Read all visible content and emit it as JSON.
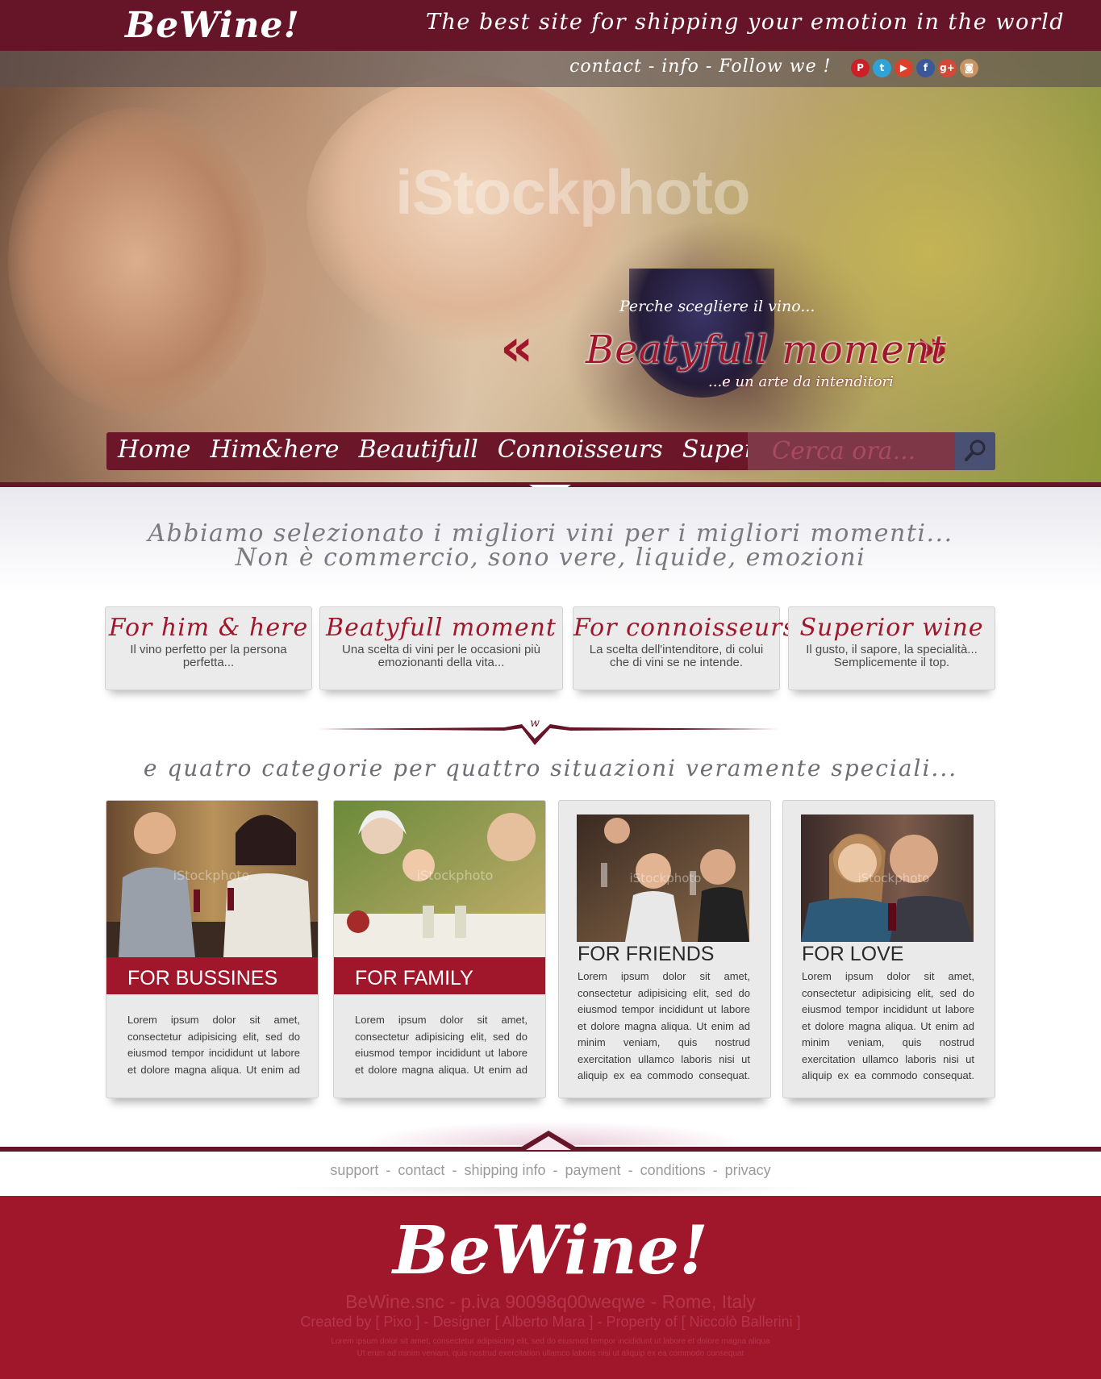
{
  "header": {
    "logo": "BeWine!",
    "tagline": "The best site for shipping your emotion in the world"
  },
  "subbar": {
    "follow_line": "contact - info - Follow we !",
    "socials": [
      {
        "icon": "pinterest-icon",
        "glyph": "P",
        "color": "#cb2027"
      },
      {
        "icon": "twitter-icon",
        "glyph": "t",
        "color": "#2fa3d5"
      },
      {
        "icon": "youtube-icon",
        "glyph": "▶",
        "color": "#d9412b"
      },
      {
        "icon": "facebook-icon",
        "glyph": "f",
        "color": "#3b5998"
      },
      {
        "icon": "google-plus-icon",
        "glyph": "g+",
        "color": "#d34836"
      },
      {
        "icon": "instagram-icon",
        "glyph": "◙",
        "color": "#c99463"
      }
    ]
  },
  "hero": {
    "watermark": "iStockphoto",
    "kicker": "Perche scegliere il vino...",
    "title": "Beatyfull moment",
    "subtitle": "...e un arte da intenditori",
    "prev_arrow": "«",
    "next_arrow": "»"
  },
  "nav": {
    "items": [
      "Home",
      "Him&here",
      "Beautifull",
      "Connoisseurs",
      "Superior"
    ],
    "search_placeholder": "Cerca ora..."
  },
  "intro": {
    "line1": "Abbiamo selezionato i migliori vini per i migliori momenti...",
    "line2": "Non è commercio, sono vere, liquide, emozioni"
  },
  "features": [
    {
      "title": "For him & here",
      "desc": "Il vino perfetto per la persona perfetta..."
    },
    {
      "title": "Beatyfull moment",
      "desc": "Una scelta di vini per le occasioni più emozionanti della vita..."
    },
    {
      "title": "For connoisseurs",
      "desc": "La scelta dell'intenditore, di colui che di vini se ne intende."
    },
    {
      "title": "Superior wine",
      "desc": "Il gusto, il sapore, la specialità... Semplicemente il top."
    }
  ],
  "divider_mark": "w",
  "categories_heading": "e quatro categorie per quattro situazioni veramente speciali...",
  "categories": [
    {
      "title": "FOR BUSSINES",
      "body": "Lorem ipsum dolor sit amet, consectetur adipisicing elit, sed do eiusmod tempor incididunt ut labore et dolore magna aliqua. Ut enim ad minim",
      "watermark": "iStockphoto"
    },
    {
      "title": "FOR FAMILY",
      "body": "Lorem ipsum dolor sit amet, consectetur adipisicing elit, sed do eiusmod tempor incididunt ut labore et dolore magna aliqua. Ut enim ad minim",
      "watermark": "iStockphoto"
    },
    {
      "title": "FOR FRIENDS",
      "body": "Lorem ipsum dolor sit amet, consectetur adipisicing elit, sed do eiusmod tempor incididunt ut labore et dolore magna aliqua. Ut enim ad minim veniam, quis nostrud exercitation ullamco laboris nisi ut aliquip ex ea commodo consequat. Duis aute irure",
      "watermark": "iStockphoto"
    },
    {
      "title": "FOR LOVE",
      "body": "Lorem ipsum dolor sit amet, consectetur adipisicing elit, sed do eiusmod tempor incididunt ut labore et dolore magna aliqua. Ut enim ad minim veniam, quis nostrud exercitation ullamco laboris nisi ut aliquip ex ea commodo consequat. Duis aute irure",
      "watermark": "iStockphoto"
    }
  ],
  "footer_links": [
    "support",
    "contact",
    "shipping info",
    "payment",
    "conditions",
    "privacy"
  ],
  "footer": {
    "logo": "BeWine!",
    "company": "BeWine.snc - p.iva 90098q00weqwe - Rome, Italy",
    "credits": "Created by [ Pixo ] - Designer [ Alberto Mara ] - Property of [ Niccolò Ballerini ]",
    "small_line1": "Lorem ipsum dolor sit amet, consectetur adipisicing elit, sed do eiusmod tempor incididunt ut labore et dolore magna aliqua",
    "small_line2": "Ut enim ad minim veniam, quis nostrud exercitation ullamco laboris nisi ut aliquip ex ea commodo consequat"
  },
  "colors": {
    "wine_dark": "#661428",
    "wine_red": "#a0162b",
    "nav_bg": "#6b1629",
    "card_bg": "#eaeaea"
  }
}
